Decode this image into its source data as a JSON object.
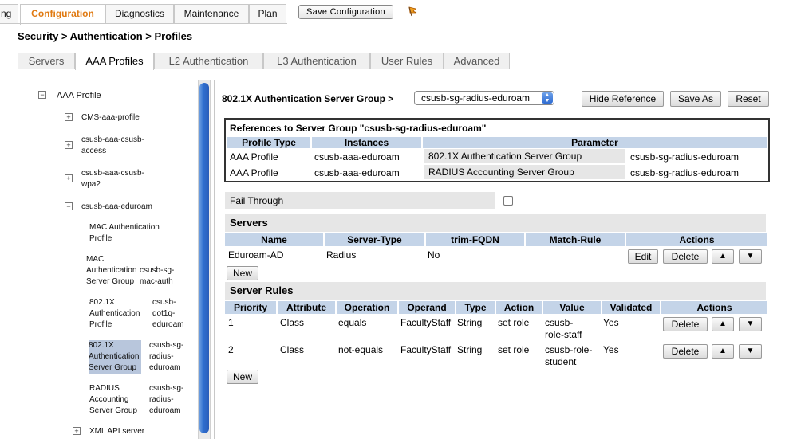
{
  "topnav": {
    "tabs": [
      {
        "label": "ng"
      },
      {
        "label": "Configuration"
      },
      {
        "label": "Diagnostics"
      },
      {
        "label": "Maintenance"
      },
      {
        "label": "Plan"
      }
    ],
    "save_config": "Save Configuration"
  },
  "breadcrumb": "Security > Authentication > Profiles",
  "subtabs": [
    "Servers",
    "AAA Profiles",
    "L2 Authentication",
    "L3 Authentication",
    "User Rules",
    "Advanced"
  ],
  "tree": {
    "root": "AAA Profile",
    "items": [
      {
        "label": "CMS-aaa-profile"
      },
      {
        "label": "csusb-aaa-csusb-access"
      },
      {
        "label": "csusb-aaa-csusb-wpa2"
      },
      {
        "label": "csusb-aaa-eduroam"
      },
      {
        "label": "MAC Authentication Profile"
      },
      {
        "label": "MAC Authentication Server Group",
        "value": "csusb-sg-mac-auth"
      },
      {
        "label": "802.1X Authentication Profile",
        "value": "csusb-dot1q-eduroam"
      },
      {
        "label": "802.1X Authentication Server Group",
        "value": "csusb-sg-radius-eduroam"
      },
      {
        "label": "RADIUS Accounting Server Group",
        "value": "csusb-sg-radius-eduroam"
      },
      {
        "label": "XML API server"
      }
    ]
  },
  "panel": {
    "title": "802.1X Authentication Server Group >",
    "selected_group": "csusb-sg-radius-eduroam",
    "buttons": {
      "hide_reference": "Hide Reference",
      "save_as": "Save As",
      "reset": "Reset"
    }
  },
  "references": {
    "title": "References to Server Group \"csusb-sg-radius-eduroam\"",
    "headers": [
      "Profile Type",
      "Instances",
      "Parameter"
    ],
    "rows": [
      {
        "type": "AAA Profile",
        "instance": "csusb-aaa-eduroam",
        "param": "802.1X Authentication Server Group",
        "value": "csusb-sg-radius-eduroam"
      },
      {
        "type": "AAA Profile",
        "instance": "csusb-aaa-eduroam",
        "param": "RADIUS Accounting Server Group",
        "value": "csusb-sg-radius-eduroam"
      }
    ]
  },
  "fail_through": {
    "label": "Fail Through",
    "checked": false
  },
  "servers": {
    "title": "Servers",
    "headers": [
      "Name",
      "Server-Type",
      "trim-FQDN",
      "Match-Rule",
      "Actions"
    ],
    "rows": [
      {
        "name": "Eduroam-AD",
        "type": "Radius",
        "trim": "No",
        "match": ""
      }
    ],
    "edit": "Edit",
    "delete": "Delete",
    "up": "▲",
    "down": "▼",
    "new": "New"
  },
  "server_rules": {
    "title": "Server Rules",
    "headers": [
      "Priority",
      "Attribute",
      "Operation",
      "Operand",
      "Type",
      "Action",
      "Value",
      "Validated",
      "Actions"
    ],
    "rows": [
      {
        "priority": "1",
        "attribute": "Class",
        "operation": "equals",
        "operand": "FacultyStaff",
        "type": "String",
        "action": "set role",
        "value": "csusb-role-staff",
        "validated": "Yes"
      },
      {
        "priority": "2",
        "attribute": "Class",
        "operation": "not-equals",
        "operand": "FacultyStaff",
        "type": "String",
        "action": "set role",
        "value": "csusb-role-student",
        "validated": "Yes"
      }
    ],
    "delete": "Delete",
    "up": "▲",
    "down": "▼",
    "new": "New"
  }
}
